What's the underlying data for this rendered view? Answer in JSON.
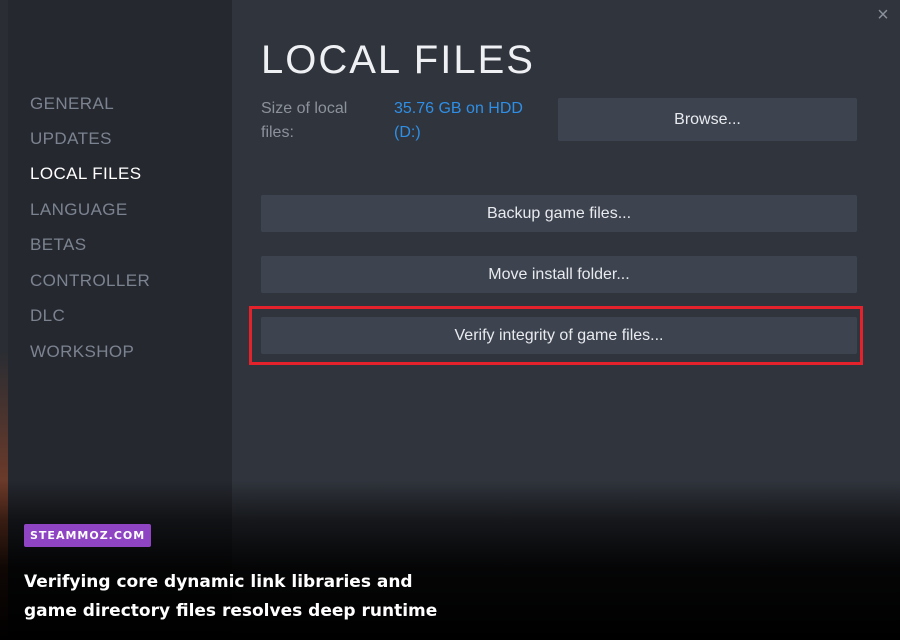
{
  "window": {
    "close_glyph": "×"
  },
  "sidebar": {
    "items": [
      {
        "label": "GENERAL",
        "active": false
      },
      {
        "label": "UPDATES",
        "active": false
      },
      {
        "label": "LOCAL FILES",
        "active": true
      },
      {
        "label": "LANGUAGE",
        "active": false
      },
      {
        "label": "BETAS",
        "active": false
      },
      {
        "label": "CONTROLLER",
        "active": false
      },
      {
        "label": "DLC",
        "active": false
      },
      {
        "label": "WORKSHOP",
        "active": false
      }
    ]
  },
  "main": {
    "title": "LOCAL FILES",
    "size_label": "Size of local files:",
    "size_value": "35.76 GB on HDD (D:)",
    "browse_label": "Browse...",
    "backup_label": "Backup game files...",
    "move_label": "Move install folder...",
    "verify_label": "Verify integrity of game files..."
  },
  "overlay": {
    "brand": "STEAMMOZ.COM",
    "caption_line1": "Verifying core dynamic link libraries and",
    "caption_line2": "game directory files resolves deep runtime"
  },
  "colors": {
    "accent_link": "#2f8fe6",
    "highlight_border": "#e3222c",
    "brand_badge": "#8e44c3"
  }
}
